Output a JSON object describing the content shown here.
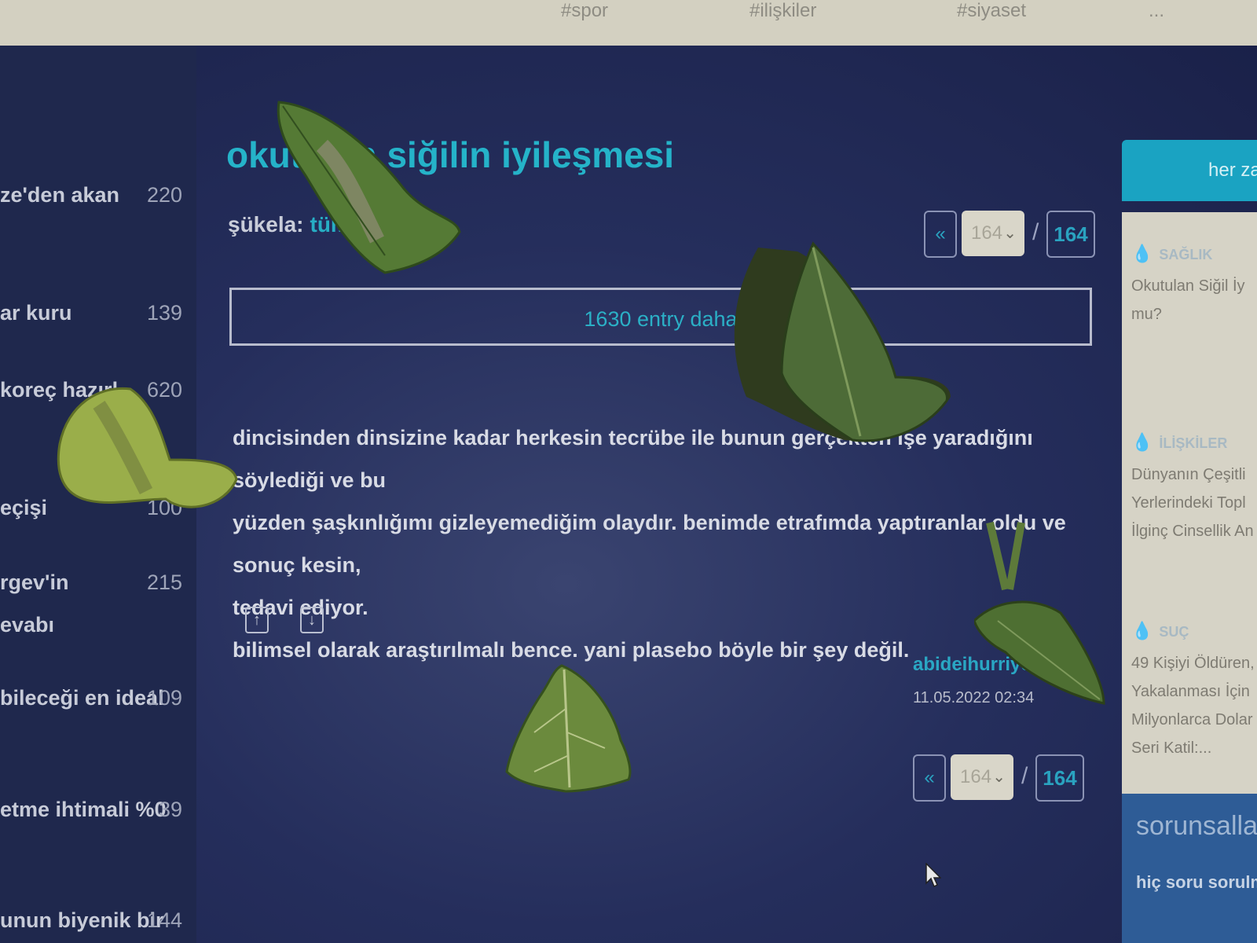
{
  "topbar": {
    "items": [
      "#spor",
      "#ilişkiler",
      "#siyaset",
      "..."
    ]
  },
  "sidebar": {
    "items": [
      {
        "label": "ze'den akan",
        "count": "220"
      },
      {
        "label": "ar kuru",
        "count": "139"
      },
      {
        "label": "koreç hazırl",
        "count": "620"
      },
      {
        "label": "eçişi",
        "count": "100"
      },
      {
        "label": "rgev'in",
        "count": "215"
      },
      {
        "label": "evabı",
        "count": ""
      },
      {
        "label": "bileceği en ideal",
        "count": "109"
      },
      {
        "label": "etme ihtimali %0",
        "count": "39"
      },
      {
        "label": "unun biyenik bir",
        "count": "144"
      }
    ]
  },
  "topic": {
    "title": "okutulan siğilin iyileşmesi",
    "sukela_label": "şükela:",
    "sukela_value": "tümü"
  },
  "pager": {
    "prev": "«",
    "current": "164",
    "separator": "/",
    "last": "164"
  },
  "more_entries": "1630 entry daha",
  "entry": {
    "lines": [
      "dincisinden dinsizine kadar herkesin tecrübe ile bunun gerçekten işe yaradığını söylediği ve bu",
      "yüzden şaşkınlığımı gizleyemediğim olaydır. benimde etrafımda yaptıranlar oldu ve sonuç kesin,",
      "tedavi ediyor.",
      "bilimsel olarak araştırılmalı bence. yani plasebo böyle bir şey değil."
    ],
    "upvote": "↑",
    "downvote": "↓",
    "author": "abideihurriyet",
    "date": "11.05.2022 02:34"
  },
  "right_panel": {
    "tab_label": "her zaman",
    "topics": [
      {
        "category": "SAĞLIK",
        "lines": [
          "Okutulan Siğil İy",
          "mu?"
        ]
      },
      {
        "category": "İLİŞKİLER",
        "lines": [
          "Dünyanın Çeşitli",
          "Yerlerindeki Topl",
          "İlginç Cinsellik An"
        ]
      },
      {
        "category": "SUÇ",
        "lines": [
          "49 Kişiyi Öldüren,",
          "Yakalanması İçin",
          "Milyonlarca Dolar",
          "Seri Katil:..."
        ]
      }
    ],
    "sorunsallar_heading": "sorunsallar",
    "hic_soru": "hiç soru sorulmamış"
  },
  "icons": {
    "drop": "drop-icon",
    "cursor": "mouse-cursor-icon",
    "chevron": "chevron-down-icon"
  },
  "colors": {
    "accent": "#25b3c9",
    "background": "#252e5c",
    "leaf": "#5a7a3a"
  }
}
